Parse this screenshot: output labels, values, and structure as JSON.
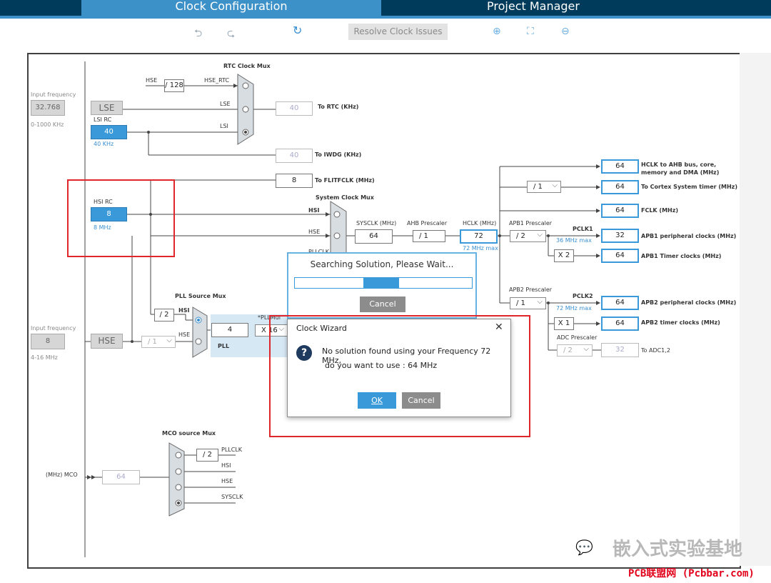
{
  "tabs": [
    {
      "label": "Clock Configuration",
      "active": true
    },
    {
      "label": "Project Manager",
      "active": false
    }
  ],
  "toolbar": {
    "undo_icon": "undo-icon",
    "redo_icon": "redo-icon",
    "refresh_icon": "refresh-icon",
    "resolve_label": "Resolve Clock Issues",
    "zoom_in_icon": "zoom-in-icon",
    "fit_icon": "fit-screen-icon",
    "zoom_out_icon": "zoom-out-icon"
  },
  "diagram": {
    "rtc_mux": "RTC Clock Mux",
    "hse": "HSE",
    "div128": "/ 128",
    "hse_rtc": "HSE_RTC",
    "input_freq": "Input frequency",
    "lse_value": "32.768",
    "lse_range": "0-1000 KHz",
    "lse": "LSE",
    "lse_line": "LSE",
    "lsi_rc": "LSI RC",
    "lsi_value": "40",
    "lsi_khz": "40 KHz",
    "lsi_line": "LSI",
    "rtc_value": "40",
    "to_rtc": "To RTC (KHz)",
    "iwdg_value": "40",
    "to_iwdg": "To IWDG (KHz)",
    "flit_value": "8",
    "to_flit": "To FLITFCLK (MHz)",
    "sys_mux": "System Clock Mux",
    "hsi_rc": "HSI RC",
    "hsi_value": "8",
    "hsi_mhz": "8 MHz",
    "hsi_line": "HSI",
    "hse_line": "HSE",
    "pllclk_line": "PLLCLK",
    "sysclk_label": "SYSCLK (MHz)",
    "sysclk_value": "64",
    "ahb_presc": "AHB Prescaler",
    "ahb_sel": "/ 1",
    "hclk_label": "HCLK (MHz)",
    "hclk_value": "72",
    "hclk_max": "72 MHz max",
    "apb1_presc": "APB1 Prescaler",
    "apb1_sel": "/ 2",
    "pclk1": "PCLK1",
    "pclk1_max": "36 MHz max",
    "x2": "X 2",
    "apb2_presc": "APB2 Prescaler",
    "apb2_sel": "/ 1",
    "pclk2": "PCLK2",
    "pclk2_max": "72 MHz max",
    "x1": "X 1",
    "adc_presc": "ADC Prescaler",
    "adc_sel": "/ 2",
    "cortex_sel": "/ 1",
    "outputs": [
      {
        "value": "64",
        "label": "HCLK to AHB bus, core,",
        "label2": "memory and DMA (MHz)"
      },
      {
        "value": "64",
        "label": "To Cortex System timer (MHz)"
      },
      {
        "value": "64",
        "label": "FCLK (MHz)"
      },
      {
        "value": "32",
        "label": "APB1 peripheral clocks (MHz)"
      },
      {
        "value": "64",
        "label": "APB1 Timer clocks (MHz)"
      },
      {
        "value": "64",
        "label": "APB2 peripheral clocks (MHz)"
      },
      {
        "value": "64",
        "label": "APB2 timer clocks (MHz)"
      },
      {
        "value": "32",
        "label": "To ADC1,2"
      }
    ],
    "pll_mux": "PLL Source Mux",
    "div2": "/ 2",
    "pll_hsi": "HSI",
    "pll_hse": "HSE",
    "pll_value": "4",
    "pll_mul_label": "*PLLMul",
    "pll_mul": "X 16",
    "pll": "PLL",
    "hse_input_freq": "Input frequency",
    "hse_value": "8",
    "hse_range": "4-16 MHz",
    "hse_box": "HSE",
    "hse_div": "/ 1",
    "mco_mux": "MCO source Mux",
    "mco_div2": "/ 2",
    "mco_pllclk": "PLLCLK",
    "mco_hsi": "HSI",
    "mco_hse": "HSE",
    "mco_sysclk": "SYSCLK",
    "mco_label": "(MHz) MCO",
    "mco_value": "64"
  },
  "searching": {
    "text": "Searching Solution, Please Wait...",
    "progress": 0.2,
    "cancel": "Cancel"
  },
  "wizard": {
    "title": "Clock Wizard",
    "msg1": "No solution found using your Frequency 72 MHz,",
    "msg2": "do you want to use :  64 MHz",
    "ok": "OK",
    "cancel": "Cancel",
    "icon": "question-icon"
  },
  "watermark": "嵌入式实验基地",
  "footer": "PCB联盟网 (Pcbbar.com)",
  "colors": {
    "accent": "#3a9ad9",
    "header": "#003b5c",
    "highlight": "#e0262b"
  }
}
